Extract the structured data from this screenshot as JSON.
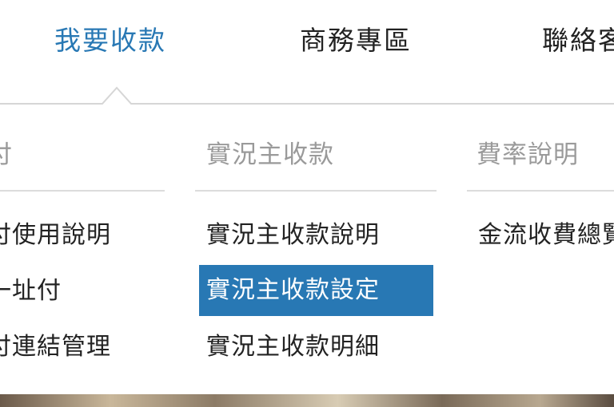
{
  "colors": {
    "accent": "#2878b4",
    "text": "#222222",
    "muted": "#9a9a9a",
    "rule": "#dcdcdc"
  },
  "nav": {
    "items": [
      {
        "label": "我要收款",
        "active": true
      },
      {
        "label": "商務專區",
        "active": false
      },
      {
        "label": "聯絡客"
      }
    ]
  },
  "dropdown": {
    "columns": [
      {
        "header": "付",
        "items": [
          {
            "label": "付使用說明"
          },
          {
            "label": "一址付"
          },
          {
            "label": "付連結管理"
          }
        ]
      },
      {
        "header": "實況主收款",
        "items": [
          {
            "label": "實況主收款說明"
          },
          {
            "label": "實況主收款設定",
            "selected": true
          },
          {
            "label": "實況主收款明細"
          }
        ]
      },
      {
        "header": "費率說明",
        "items": [
          {
            "label": "金流收費總覽"
          }
        ]
      }
    ]
  }
}
